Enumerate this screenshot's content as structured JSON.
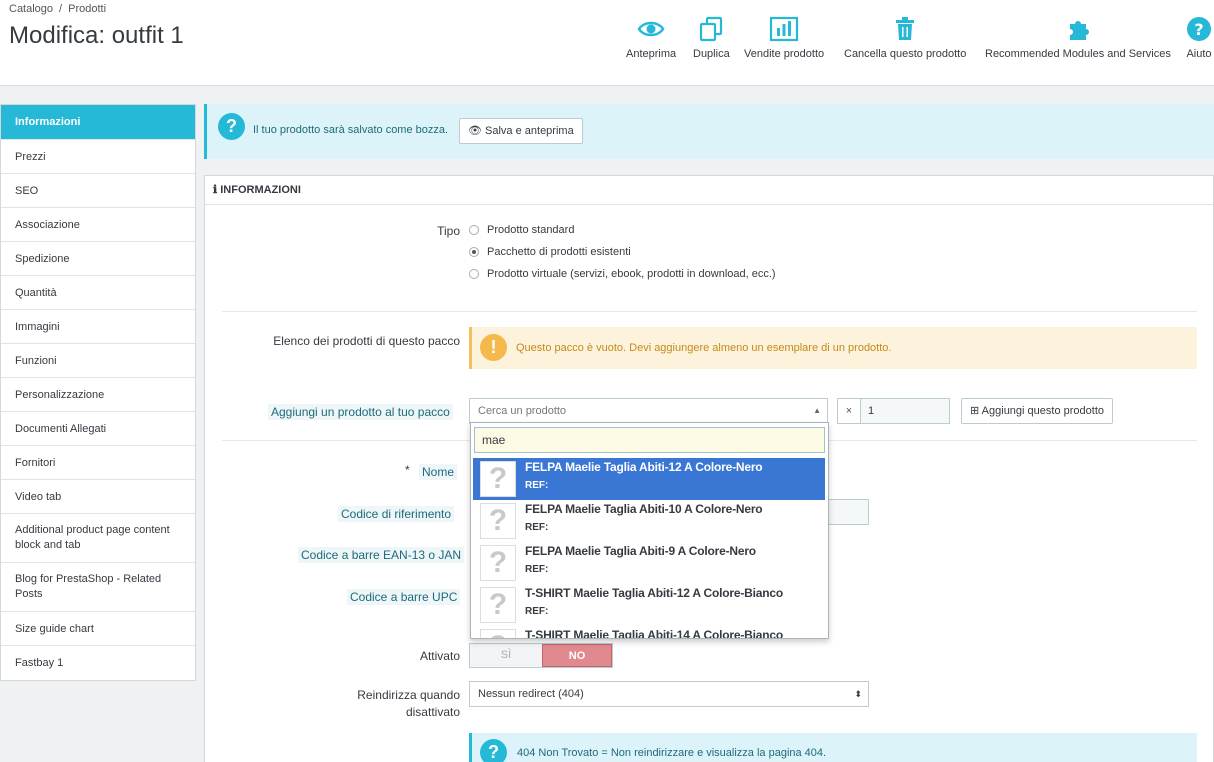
{
  "breadcrumb": {
    "parent": "Catalogo",
    "current": "Prodotti"
  },
  "page_title": "Modifica: outfit 1",
  "toolbar": {
    "preview": "Anteprima",
    "duplicate": "Duplica",
    "sales": "Vendite prodotto",
    "delete": "Cancella questo prodotto",
    "modules": "Recommended Modules and Services",
    "help": "Aiuto"
  },
  "colors": {
    "accent": "#25b9d7",
    "toolbar_icon": "#25b9d7",
    "warning": "#f5b84a",
    "danger": "#e08a8f",
    "highlight": "#3a76d3"
  },
  "sidebar": {
    "items": [
      {
        "label": "Informazioni"
      },
      {
        "label": "Prezzi"
      },
      {
        "label": "SEO"
      },
      {
        "label": "Associazione"
      },
      {
        "label": "Spedizione"
      },
      {
        "label": "Quantità"
      },
      {
        "label": "Immagini"
      },
      {
        "label": "Funzioni"
      },
      {
        "label": "Personalizzazione"
      },
      {
        "label": "Documenti Allegati"
      },
      {
        "label": "Fornitori"
      },
      {
        "label": "Video tab"
      },
      {
        "label": "Additional product page content block and tab"
      },
      {
        "label": "Blog for PrestaShop - Related Posts"
      },
      {
        "label": "Size guide chart"
      },
      {
        "label": "Fastbay 1"
      }
    ]
  },
  "draft_alert": {
    "message": "Il tuo prodotto sarà salvato come bozza.",
    "button": "Salva e anteprima"
  },
  "panel": {
    "heading": "INFORMAZIONI",
    "type_label": "Tipo",
    "type_options": [
      {
        "label": "Prodotto standard",
        "selected": false
      },
      {
        "label": "Pacchetto di prodotti esistenti",
        "selected": true
      },
      {
        "label": "Prodotto virtuale (servizi, ebook, prodotti in download, ecc.)",
        "selected": false
      }
    ],
    "pack_list_label": "Elenco dei prodotti di questo pacco",
    "pack_empty_warning": "Questo pacco è vuoto. Devi aggiungere almeno un esemplare di un prodotto.",
    "add_product_label": "Aggiungi un prodotto al tuo pacco",
    "search_placeholder": "Cerca un prodotto",
    "qty_prefix": "×",
    "qty_value": "1",
    "add_button": "Aggiungi questo prodotto",
    "name_required": "*",
    "name_label": "Nome",
    "reference_label": "Codice di riferimento",
    "ean_label": "Codice a barre EAN-13 o JAN",
    "upc_label": "Codice a barre UPC",
    "active_label": "Attivato",
    "toggle_yes": "SÌ",
    "toggle_no": "NO",
    "redirect_label_1": "Reindirizza quando",
    "redirect_label_2": "disattivato",
    "redirect_value": "Nessun redirect (404)",
    "redirect_info": "404 Non Trovato = Non reindirizzare e visualizza la pagina 404."
  },
  "dropdown": {
    "query": "mae",
    "results": [
      {
        "name": "FELPA Maelie Taglia Abiti-12 A Colore-Nero",
        "ref": "REF:",
        "highlighted": true
      },
      {
        "name": "FELPA Maelie Taglia Abiti-10 A Colore-Nero",
        "ref": "REF:",
        "highlighted": false
      },
      {
        "name": "FELPA Maelie Taglia Abiti-9 A Colore-Nero",
        "ref": "REF:",
        "highlighted": false
      },
      {
        "name": "T-SHIRT Maelie Taglia Abiti-12 A Colore-Bianco",
        "ref": "REF:",
        "highlighted": false
      },
      {
        "name": "T-SHIRT Maelie Taglia Abiti-14 A Colore-Bianco",
        "ref": "",
        "highlighted": false
      }
    ]
  }
}
